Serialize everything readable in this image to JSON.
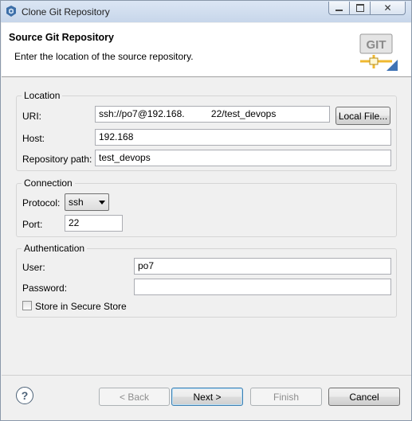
{
  "window": {
    "title": "Clone Git Repository",
    "minimize_icon": "minimize-icon",
    "maximize_icon": "maximize-icon",
    "close_icon": "close-icon"
  },
  "header": {
    "title": "Source Git Repository",
    "description": "Enter the location of the source repository.",
    "logo_text": "GIT"
  },
  "location": {
    "group_title": "Location",
    "uri_label": "URI:",
    "uri_value": "ssh://po7@192.168.          22/test_devops",
    "local_file_button": "Local File...",
    "host_label": "Host:",
    "host_value": "192.168",
    "repo_path_label": "Repository path:",
    "repo_path_value": "test_devops"
  },
  "connection": {
    "group_title": "Connection",
    "protocol_label": "Protocol:",
    "protocol_value": "ssh",
    "port_label": "Port:",
    "port_value": "22"
  },
  "authentication": {
    "group_title": "Authentication",
    "user_label": "User:",
    "user_value": "po7",
    "password_label": "Password:",
    "password_value": "",
    "store_label": "Store in Secure Store",
    "store_checked": false
  },
  "footer": {
    "back_button": "< Back",
    "next_button": "Next >",
    "finish_button": "Finish",
    "cancel_button": "Cancel",
    "help_icon": "?"
  },
  "colors": {
    "titlebar": "#c7d6ea",
    "dialog_bg": "#f0f0f0",
    "banner_bg": "#ffffff",
    "default_button_border": "#3c7fb1"
  }
}
